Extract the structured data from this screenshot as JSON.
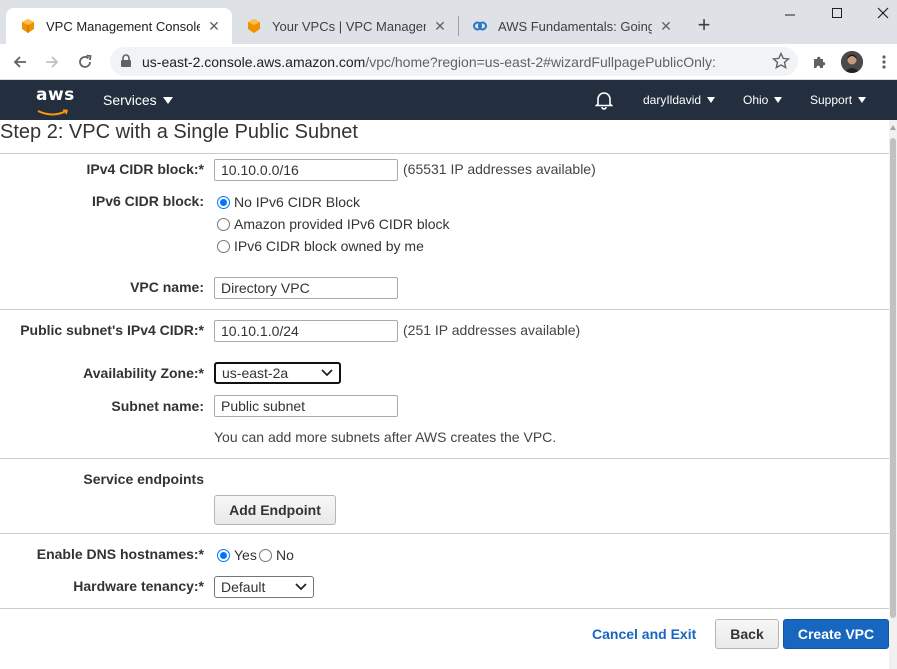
{
  "browser": {
    "tabs": [
      {
        "title": "VPC Management Console",
        "active": true
      },
      {
        "title": "Your VPCs | VPC Management",
        "active": false
      },
      {
        "title": "AWS Fundamentals: Going Clo",
        "active": false
      }
    ],
    "url_host": "us-east-2.console.aws.amazon.com",
    "url_path": "/vpc/home?region=us-east-2#wizardFullpagePublicOnly:"
  },
  "aws_nav": {
    "logo": "aws",
    "services": "Services",
    "user": "daryIldavid",
    "region": "Ohio",
    "support": "Support"
  },
  "page": {
    "title": "Step 2: VPC with a Single Public Subnet"
  },
  "form": {
    "ipv4_cidr": {
      "label": "IPv4 CIDR block:*",
      "value": "10.10.0.0/16",
      "note": "(65531 IP addresses available)"
    },
    "ipv6_cidr": {
      "label": "IPv6 CIDR block:",
      "options": [
        {
          "label": "No IPv6 CIDR Block",
          "selected": true
        },
        {
          "label": "Amazon provided IPv6 CIDR block",
          "selected": false
        },
        {
          "label": "IPv6 CIDR block owned by me",
          "selected": false
        }
      ]
    },
    "vpc_name": {
      "label": "VPC name:",
      "value": "Directory VPC"
    },
    "subnet_cidr": {
      "label": "Public subnet's IPv4 CIDR:*",
      "value": "10.10.1.0/24",
      "note": "(251 IP addresses available)"
    },
    "availability_zone": {
      "label": "Availability Zone:*",
      "value": "us-east-2a"
    },
    "subnet_name": {
      "label": "Subnet name:",
      "value": "Public subnet"
    },
    "subnet_hint": "You can add more subnets after AWS creates the VPC.",
    "service_endpoints": {
      "label": "Service endpoints",
      "button": "Add Endpoint"
    },
    "dns_hostnames": {
      "label": "Enable DNS hostnames:*",
      "yes": "Yes",
      "no": "No",
      "selected": "Yes"
    },
    "tenancy": {
      "label": "Hardware tenancy:*",
      "value": "Default"
    }
  },
  "actions": {
    "cancel": "Cancel and Exit",
    "back": "Back",
    "create": "Create VPC"
  },
  "colors": {
    "aws_nav_bg": "#232f3e",
    "aws_orange": "#ff9900",
    "primary_button": "#1766c0"
  }
}
